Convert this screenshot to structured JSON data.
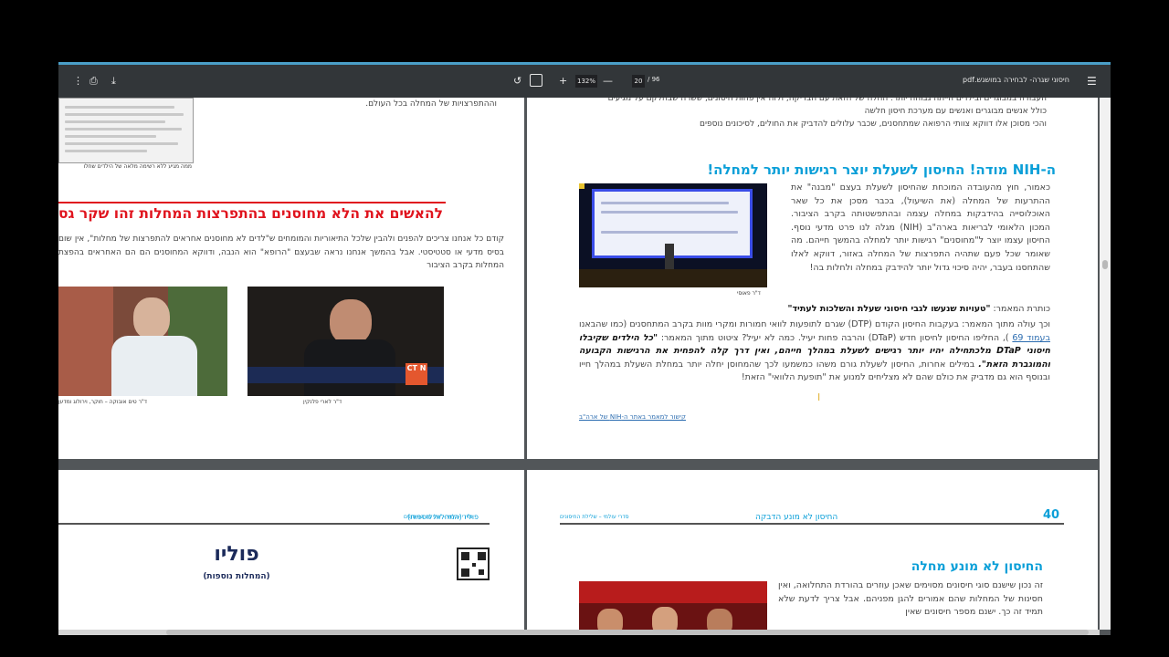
{
  "toolbar": {
    "doc_title": "חיסוני שגרה- לבחירה במושגש.pdf",
    "page_current": "20",
    "page_total": "/ 96",
    "zoom": "132%",
    "icons": [
      "menu-icon",
      "zoom-out-icon",
      "zoom-in-icon",
      "fit-page-icon",
      "rotate-icon",
      "download-icon",
      "print-icon",
      "more-vert-icon"
    ]
  },
  "page_tr": {
    "top_lines": [
      "העבודה במבוגרים ובילדים הייתה גבוהה יותר. החלה של הזאת עם הבדיקה, ולזה אין פחות חיסונים, ששרה שבחלקם על מגיעים",
      "כולל אנשים מבוגרים ואנשים עם מערכת חיסון חלשה",
      "והכי מסוכן אלו דווקא צוותי הרפואה שמתחסנים, שכבר עלולים להדביק את החולים, לסיכונים נוספים"
    ],
    "heading": "ה-NIH מודה! החיסון לשעלת יוצר רגישות יותר למחלה!",
    "para1": "כאמור, חוץ מהעובדה המוכחת שהחיסון לשעלת בעצם \"מבנה\" את ההתרעות של המחלה (את השיעול), בכבר מסכן את כל שאר האוכלוסייה בהידבקות במחלה עצמה ובהתפשטותה בקרב הציבור. המכון הלאומי לבריאות בארה\"ב (NIH) מגלה לנו פרט מדעי נוסף. החיסון עצמו יוצר ל\"מחוסנים\" רגישות יותר למחלה בהמשך חייהם. מה שאומר שכל פעם שתהיה התפרצות של המחלה באזור, דווקא לאלו שהתחסנו בעבר, יהיה סיכוי גדול יותר להידבק במחלה ולחלות בה!",
    "image_caption": "ד\"ר פאוסי",
    "article_title_prefix": "כותרת המאמר:",
    "article_title": "\"טעויות שנעשו לגבי חיסוני שעלת והשלכות לעתיד\"",
    "para2a": "וכך עולה מתוך המאמר: בעקבות החיסון הקודם (DTP) שגרם לתופעות לוואי חמורות ומקרי מוות בקרב המתחסנים (כמו שהבאנו",
    "para2_link": "בעמוד 69",
    "para2b": "), החליפו החיסון לחיסון חדש (DTaP) והרבה פחות יעיל. כמה לא יעיל? ציטוט מתוך המאמר:",
    "para2_quote": "\"כל הילדים שקיבלו חיסוני DTaP מלכתחילה יהיו יותר רגישים לשעלת במהלך חייהם, ואין דרך קלה להפחית את הרגישות הקבועה והמוגברת הזאת\".",
    "para2c": "במילים אחרות, החיסון לשעלת גורם משהו כמשמעו לכך שהמחוסן יחלה יותר במחלת השעלת במהלך חייו ובנוסף הוא גם מדביק את כולם שהם לא מצליחים למנוע את \"תופעת הלוואי\" הזאת!",
    "bottom_link": "קישור למאמר באתר ה-NIH של ארה\"ב"
  },
  "page_tl": {
    "top_line": "וההתפרצויות של המחלה בכל העולם.",
    "thumb_caption": "ממה מגיע ללא רשימה מלאה של הילדים שחלו",
    "heading": "להאשים את הלא מחוסנים בהתפרצות המחלות זהו שקר גס",
    "para": "קודם כל אנחנו צריכים להפנים ולהבין שלכל התיאוריות והמומחים ש\"לדים לא מחוסנים אחראים להתפרצות של מחלות\", אין שום בסיס מדעי או סטטיסטי. אבל בהמשך אנחנו נראה שבעצם \"הרופא\" הוא הנבה, ודווקא המחוסנים הם הם האחראים בהפצת המחלות בקרב הציבור",
    "caption_left": "ד\"ר לארי פלנקין",
    "caption_right": "ד\"ר טים אובוקה – חוקר, וירולוג ומדען",
    "badge_text": "CT N"
  },
  "page_bl": {
    "header_right": "סדרי עולמי – שלילת החיסונים",
    "header_left": "פוליו (המחלות נוספות)",
    "title": "פוליו",
    "subtitle": "(המחלות נוספות)"
  },
  "page_br": {
    "header_right": "החיסון לא מונע הדבקה",
    "header_left": "סדרי עולמי – שלילת החיסונים",
    "page_number": "40",
    "heading": "החיסון לא מונע מחלה",
    "para": "זה נכון שישנם סוגי חיסונים מסוימים שאכן עוזרים בהורדת התחלואה, ואין חסינות של המחלות שהם אמורים להגן מפניהם. אבל צריך לדעת שלא תמיד זה כך. ישנם מספר חיסונים שאין"
  },
  "colors": {
    "accent_blue": "#0a9fd8",
    "heading_red": "#e0141e",
    "toolbar": "#323639",
    "viewer_bg": "#525659"
  }
}
